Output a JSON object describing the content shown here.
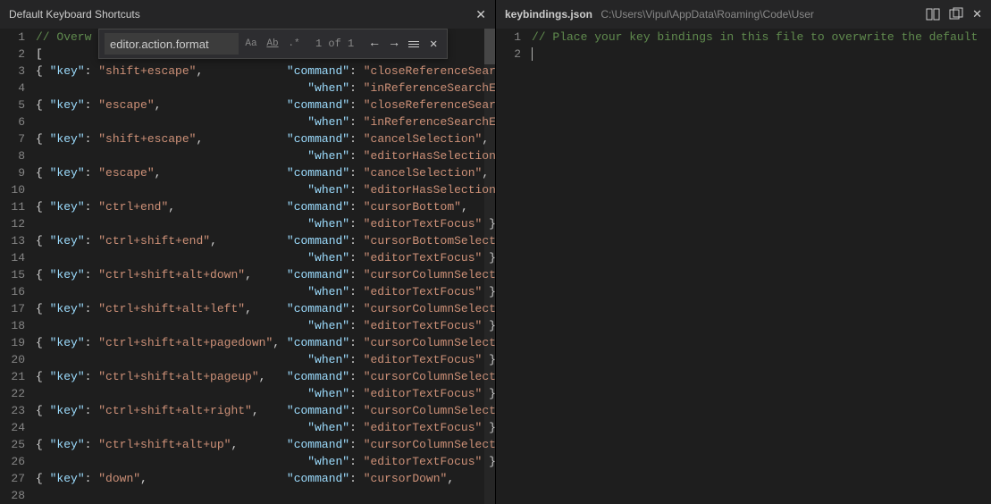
{
  "left": {
    "tab_title": "Default Keyboard Shortcuts",
    "find": {
      "value": "editor.action.format",
      "case_label": "Aa",
      "word_label": "Ab",
      "regex_label": ".*",
      "count": "1 of 1",
      "prev": "←",
      "next": "→",
      "close": "✕"
    },
    "lines": [
      {
        "n": 1,
        "t": "comment",
        "text": "// Overw"
      },
      {
        "n": 2,
        "t": "raw",
        "parts": [
          {
            "c": "brace",
            "v": "["
          }
        ]
      },
      {
        "n": 3,
        "t": "kv",
        "key": "shift+escape",
        "command": "closeReferenceSearch",
        "trail": ","
      },
      {
        "n": 4,
        "t": "when",
        "when": "inReferenceSearchEd",
        "trail": ""
      },
      {
        "n": 5,
        "t": "kv",
        "key": "escape",
        "command": "closeReferenceSearch",
        "trail": ","
      },
      {
        "n": 6,
        "t": "when",
        "when": "inReferenceSearchEd",
        "trail": ""
      },
      {
        "n": 7,
        "t": "kv",
        "key": "shift+escape",
        "command": "cancelSelection",
        "trail": ","
      },
      {
        "n": 8,
        "t": "when",
        "when": "editorHasSelection",
        "trail": ""
      },
      {
        "n": 9,
        "t": "kv",
        "key": "escape",
        "command": "cancelSelection",
        "trail": ","
      },
      {
        "n": 10,
        "t": "when",
        "when": "editorHasSelection ",
        "trail": ""
      },
      {
        "n": 11,
        "t": "kv",
        "key": "ctrl+end",
        "command": "cursorBottom",
        "trail": ","
      },
      {
        "n": 12,
        "t": "when",
        "when": "editorTextFocus",
        "trail": " },"
      },
      {
        "n": 13,
        "t": "kv",
        "key": "ctrl+shift+end",
        "command": "cursorBottomSelect",
        "trail": ""
      },
      {
        "n": 14,
        "t": "when",
        "when": "editorTextFocus",
        "trail": " },"
      },
      {
        "n": 15,
        "t": "kv",
        "key": "ctrl+shift+alt+down",
        "command": "cursorColumnSelectD",
        "trail": ""
      },
      {
        "n": 16,
        "t": "when",
        "when": "editorTextFocus",
        "trail": " },"
      },
      {
        "n": 17,
        "t": "kv",
        "key": "ctrl+shift+alt+left",
        "command": "cursorColumnSelectL",
        "trail": ""
      },
      {
        "n": 18,
        "t": "when",
        "when": "editorTextFocus",
        "trail": " },"
      },
      {
        "n": 19,
        "t": "kv",
        "key": "ctrl+shift+alt+pagedown",
        "command": "cursorColumnSelect",
        "trail": ""
      },
      {
        "n": 20,
        "t": "when",
        "when": "editorTextFocus",
        "trail": " },"
      },
      {
        "n": 21,
        "t": "kv",
        "key": "ctrl+shift+alt+pageup",
        "command": "cursorColumnSelectP",
        "trail": ""
      },
      {
        "n": 22,
        "t": "when",
        "when": "editorTextFocus",
        "trail": " },"
      },
      {
        "n": 23,
        "t": "kv",
        "key": "ctrl+shift+alt+right",
        "command": "cursorColumnSelectR",
        "trail": ""
      },
      {
        "n": 24,
        "t": "when",
        "when": "editorTextFocus",
        "trail": " },"
      },
      {
        "n": 25,
        "t": "kv",
        "key": "ctrl+shift+alt+up",
        "command": "cursorColumnSelectU",
        "trail": ""
      },
      {
        "n": 26,
        "t": "when",
        "when": "editorTextFocus",
        "trail": " },"
      },
      {
        "n": 27,
        "t": "kv",
        "key": "down",
        "command": "cursorDown",
        "trail": ","
      },
      {
        "n": 28,
        "t": "empty"
      }
    ]
  },
  "right": {
    "tab_title": "keybindings.json",
    "tab_path": "C:\\Users\\Vipul\\AppData\\Roaming\\Code\\User",
    "lines": [
      {
        "n": 1,
        "t": "comment",
        "text": "// Place your key bindings in this file to overwrite the default"
      },
      {
        "n": 2,
        "t": "cursor"
      }
    ]
  }
}
